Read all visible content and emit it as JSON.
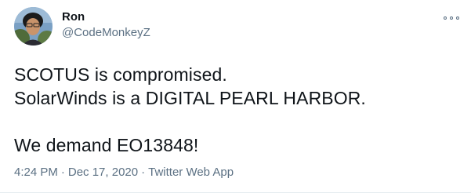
{
  "author": {
    "display_name": "Ron",
    "handle": "@CodeMonkeyZ",
    "avatar_icon": "profile-photo"
  },
  "more_icon": "more-options-icon",
  "tweet": {
    "lines": [
      "SCOTUS is compromised.",
      "SolarWinds is a DIGITAL PEARL HARBOR.",
      "",
      "We demand EO13848!"
    ]
  },
  "meta": {
    "time": "4:24 PM",
    "date": "Dec 17, 2020",
    "source": "Twitter Web App",
    "separator": "·"
  },
  "colors": {
    "text": "#0f1419",
    "secondary": "#5b7083",
    "background": "#ffffff"
  }
}
